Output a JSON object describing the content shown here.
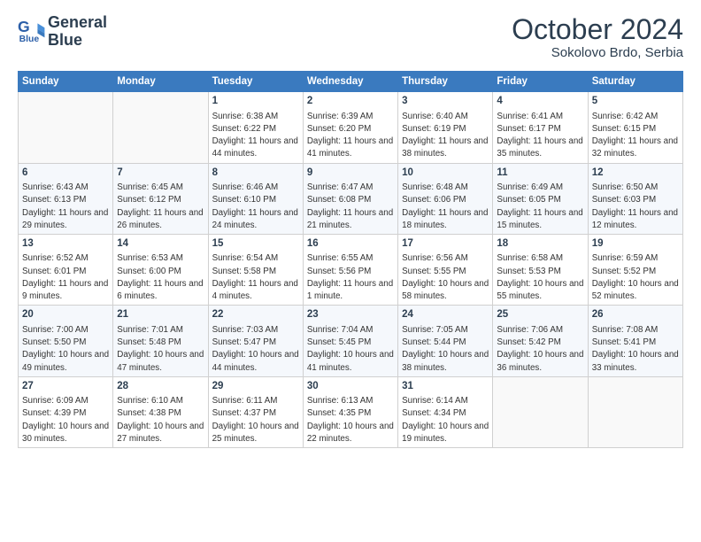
{
  "logo": {
    "line1": "General",
    "line2": "Blue"
  },
  "title": "October 2024",
  "location": "Sokolovo Brdo, Serbia",
  "weekdays": [
    "Sunday",
    "Monday",
    "Tuesday",
    "Wednesday",
    "Thursday",
    "Friday",
    "Saturday"
  ],
  "weeks": [
    [
      {
        "day": "",
        "sunrise": "",
        "sunset": "",
        "daylight": ""
      },
      {
        "day": "",
        "sunrise": "",
        "sunset": "",
        "daylight": ""
      },
      {
        "day": "1",
        "sunrise": "Sunrise: 6:38 AM",
        "sunset": "Sunset: 6:22 PM",
        "daylight": "Daylight: 11 hours and 44 minutes."
      },
      {
        "day": "2",
        "sunrise": "Sunrise: 6:39 AM",
        "sunset": "Sunset: 6:20 PM",
        "daylight": "Daylight: 11 hours and 41 minutes."
      },
      {
        "day": "3",
        "sunrise": "Sunrise: 6:40 AM",
        "sunset": "Sunset: 6:19 PM",
        "daylight": "Daylight: 11 hours and 38 minutes."
      },
      {
        "day": "4",
        "sunrise": "Sunrise: 6:41 AM",
        "sunset": "Sunset: 6:17 PM",
        "daylight": "Daylight: 11 hours and 35 minutes."
      },
      {
        "day": "5",
        "sunrise": "Sunrise: 6:42 AM",
        "sunset": "Sunset: 6:15 PM",
        "daylight": "Daylight: 11 hours and 32 minutes."
      }
    ],
    [
      {
        "day": "6",
        "sunrise": "Sunrise: 6:43 AM",
        "sunset": "Sunset: 6:13 PM",
        "daylight": "Daylight: 11 hours and 29 minutes."
      },
      {
        "day": "7",
        "sunrise": "Sunrise: 6:45 AM",
        "sunset": "Sunset: 6:12 PM",
        "daylight": "Daylight: 11 hours and 26 minutes."
      },
      {
        "day": "8",
        "sunrise": "Sunrise: 6:46 AM",
        "sunset": "Sunset: 6:10 PM",
        "daylight": "Daylight: 11 hours and 24 minutes."
      },
      {
        "day": "9",
        "sunrise": "Sunrise: 6:47 AM",
        "sunset": "Sunset: 6:08 PM",
        "daylight": "Daylight: 11 hours and 21 minutes."
      },
      {
        "day": "10",
        "sunrise": "Sunrise: 6:48 AM",
        "sunset": "Sunset: 6:06 PM",
        "daylight": "Daylight: 11 hours and 18 minutes."
      },
      {
        "day": "11",
        "sunrise": "Sunrise: 6:49 AM",
        "sunset": "Sunset: 6:05 PM",
        "daylight": "Daylight: 11 hours and 15 minutes."
      },
      {
        "day": "12",
        "sunrise": "Sunrise: 6:50 AM",
        "sunset": "Sunset: 6:03 PM",
        "daylight": "Daylight: 11 hours and 12 minutes."
      }
    ],
    [
      {
        "day": "13",
        "sunrise": "Sunrise: 6:52 AM",
        "sunset": "Sunset: 6:01 PM",
        "daylight": "Daylight: 11 hours and 9 minutes."
      },
      {
        "day": "14",
        "sunrise": "Sunrise: 6:53 AM",
        "sunset": "Sunset: 6:00 PM",
        "daylight": "Daylight: 11 hours and 6 minutes."
      },
      {
        "day": "15",
        "sunrise": "Sunrise: 6:54 AM",
        "sunset": "Sunset: 5:58 PM",
        "daylight": "Daylight: 11 hours and 4 minutes."
      },
      {
        "day": "16",
        "sunrise": "Sunrise: 6:55 AM",
        "sunset": "Sunset: 5:56 PM",
        "daylight": "Daylight: 11 hours and 1 minute."
      },
      {
        "day": "17",
        "sunrise": "Sunrise: 6:56 AM",
        "sunset": "Sunset: 5:55 PM",
        "daylight": "Daylight: 10 hours and 58 minutes."
      },
      {
        "day": "18",
        "sunrise": "Sunrise: 6:58 AM",
        "sunset": "Sunset: 5:53 PM",
        "daylight": "Daylight: 10 hours and 55 minutes."
      },
      {
        "day": "19",
        "sunrise": "Sunrise: 6:59 AM",
        "sunset": "Sunset: 5:52 PM",
        "daylight": "Daylight: 10 hours and 52 minutes."
      }
    ],
    [
      {
        "day": "20",
        "sunrise": "Sunrise: 7:00 AM",
        "sunset": "Sunset: 5:50 PM",
        "daylight": "Daylight: 10 hours and 49 minutes."
      },
      {
        "day": "21",
        "sunrise": "Sunrise: 7:01 AM",
        "sunset": "Sunset: 5:48 PM",
        "daylight": "Daylight: 10 hours and 47 minutes."
      },
      {
        "day": "22",
        "sunrise": "Sunrise: 7:03 AM",
        "sunset": "Sunset: 5:47 PM",
        "daylight": "Daylight: 10 hours and 44 minutes."
      },
      {
        "day": "23",
        "sunrise": "Sunrise: 7:04 AM",
        "sunset": "Sunset: 5:45 PM",
        "daylight": "Daylight: 10 hours and 41 minutes."
      },
      {
        "day": "24",
        "sunrise": "Sunrise: 7:05 AM",
        "sunset": "Sunset: 5:44 PM",
        "daylight": "Daylight: 10 hours and 38 minutes."
      },
      {
        "day": "25",
        "sunrise": "Sunrise: 7:06 AM",
        "sunset": "Sunset: 5:42 PM",
        "daylight": "Daylight: 10 hours and 36 minutes."
      },
      {
        "day": "26",
        "sunrise": "Sunrise: 7:08 AM",
        "sunset": "Sunset: 5:41 PM",
        "daylight": "Daylight: 10 hours and 33 minutes."
      }
    ],
    [
      {
        "day": "27",
        "sunrise": "Sunrise: 6:09 AM",
        "sunset": "Sunset: 4:39 PM",
        "daylight": "Daylight: 10 hours and 30 minutes."
      },
      {
        "day": "28",
        "sunrise": "Sunrise: 6:10 AM",
        "sunset": "Sunset: 4:38 PM",
        "daylight": "Daylight: 10 hours and 27 minutes."
      },
      {
        "day": "29",
        "sunrise": "Sunrise: 6:11 AM",
        "sunset": "Sunset: 4:37 PM",
        "daylight": "Daylight: 10 hours and 25 minutes."
      },
      {
        "day": "30",
        "sunrise": "Sunrise: 6:13 AM",
        "sunset": "Sunset: 4:35 PM",
        "daylight": "Daylight: 10 hours and 22 minutes."
      },
      {
        "day": "31",
        "sunrise": "Sunrise: 6:14 AM",
        "sunset": "Sunset: 4:34 PM",
        "daylight": "Daylight: 10 hours and 19 minutes."
      },
      {
        "day": "",
        "sunrise": "",
        "sunset": "",
        "daylight": ""
      },
      {
        "day": "",
        "sunrise": "",
        "sunset": "",
        "daylight": ""
      }
    ]
  ]
}
